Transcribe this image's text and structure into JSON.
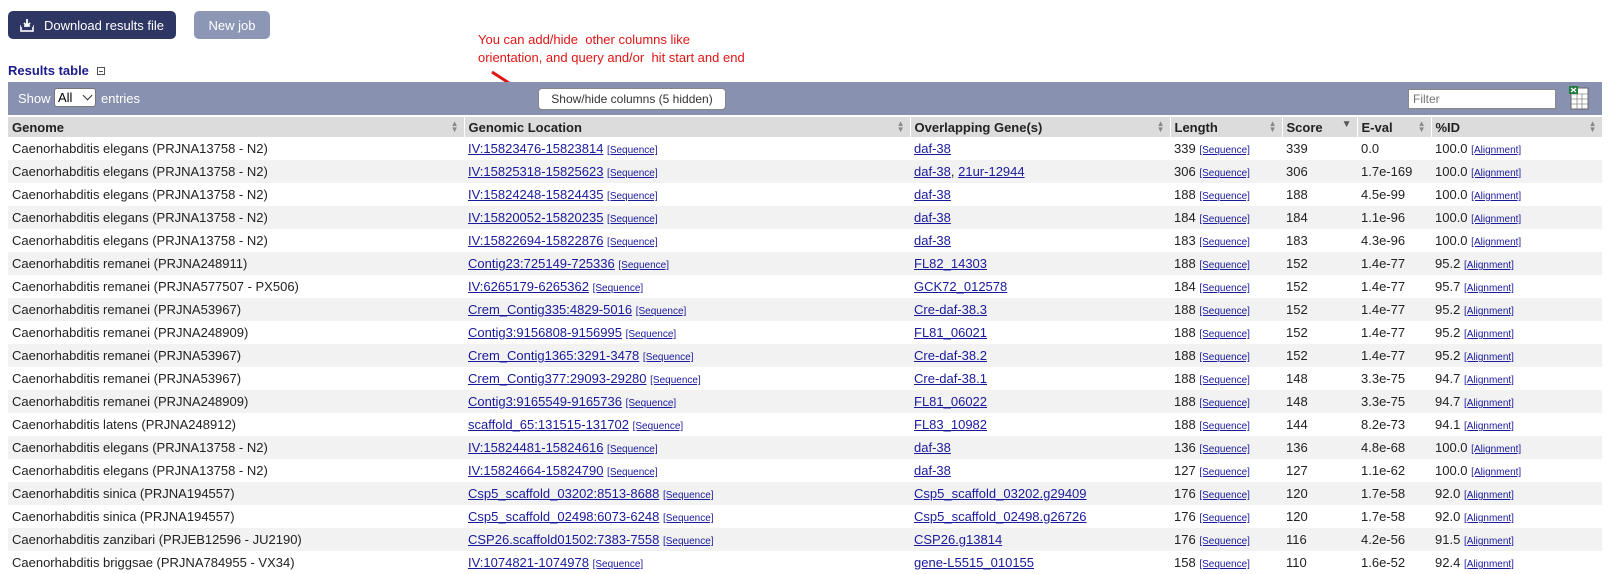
{
  "buttons": {
    "download": "Download results file",
    "new_job": "New job"
  },
  "annotation": {
    "line1": "You can add/hide  other columns like",
    "line2": "orientation, and query and/or  hit start and end"
  },
  "results_title": "Results table",
  "toolbar": {
    "show": "Show",
    "show_value": "All",
    "entries": "entries",
    "colvis": "Show/hide columns (5 hidden)",
    "filter_placeholder": "Filter"
  },
  "columns": [
    "Genome",
    "Genomic Location",
    "Overlapping Gene(s)",
    "Length",
    "Score",
    "E-val",
    "%ID"
  ],
  "link_labels": {
    "sequence": "[Sequence]",
    "alignment": "[Alignment]"
  },
  "rows": [
    {
      "genome": "Caenorhabditis elegans (PRJNA13758 - N2)",
      "location": "IV:15823476-15823814",
      "genes": [
        "daf-38"
      ],
      "length": "339",
      "score": "339",
      "eval": "0.0",
      "pid": "100.0"
    },
    {
      "genome": "Caenorhabditis elegans (PRJNA13758 - N2)",
      "location": "IV:15825318-15825623",
      "genes": [
        "daf-38",
        "21ur-12944"
      ],
      "length": "306",
      "score": "306",
      "eval": "1.7e-169",
      "pid": "100.0"
    },
    {
      "genome": "Caenorhabditis elegans (PRJNA13758 - N2)",
      "location": "IV:15824248-15824435",
      "genes": [
        "daf-38"
      ],
      "length": "188",
      "score": "188",
      "eval": "4.5e-99",
      "pid": "100.0"
    },
    {
      "genome": "Caenorhabditis elegans (PRJNA13758 - N2)",
      "location": "IV:15820052-15820235",
      "genes": [
        "daf-38"
      ],
      "length": "184",
      "score": "184",
      "eval": "1.1e-96",
      "pid": "100.0"
    },
    {
      "genome": "Caenorhabditis elegans (PRJNA13758 - N2)",
      "location": "IV:15822694-15822876",
      "genes": [
        "daf-38"
      ],
      "length": "183",
      "score": "183",
      "eval": "4.3e-96",
      "pid": "100.0"
    },
    {
      "genome": "Caenorhabditis remanei (PRJNA248911)",
      "location": "Contig23:725149-725336",
      "genes": [
        "FL82_14303"
      ],
      "length": "188",
      "score": "152",
      "eval": "1.4e-77",
      "pid": "95.2"
    },
    {
      "genome": "Caenorhabditis remanei (PRJNA577507 - PX506)",
      "location": "IV:6265179-6265362",
      "genes": [
        "GCK72_012578"
      ],
      "length": "184",
      "score": "152",
      "eval": "1.4e-77",
      "pid": "95.7"
    },
    {
      "genome": "Caenorhabditis remanei (PRJNA53967)",
      "location": "Crem_Contig335:4829-5016",
      "genes": [
        "Cre-daf-38.3"
      ],
      "length": "188",
      "score": "152",
      "eval": "1.4e-77",
      "pid": "95.2"
    },
    {
      "genome": "Caenorhabditis remanei (PRJNA248909)",
      "location": "Contig3:9156808-9156995",
      "genes": [
        "FL81_06021"
      ],
      "length": "188",
      "score": "152",
      "eval": "1.4e-77",
      "pid": "95.2"
    },
    {
      "genome": "Caenorhabditis remanei (PRJNA53967)",
      "location": "Crem_Contig1365:3291-3478",
      "genes": [
        "Cre-daf-38.2"
      ],
      "length": "188",
      "score": "152",
      "eval": "1.4e-77",
      "pid": "95.2"
    },
    {
      "genome": "Caenorhabditis remanei (PRJNA53967)",
      "location": "Crem_Contig377:29093-29280",
      "genes": [
        "Cre-daf-38.1"
      ],
      "length": "188",
      "score": "148",
      "eval": "3.3e-75",
      "pid": "94.7"
    },
    {
      "genome": "Caenorhabditis remanei (PRJNA248909)",
      "location": "Contig3:9165549-9165736",
      "genes": [
        "FL81_06022"
      ],
      "length": "188",
      "score": "148",
      "eval": "3.3e-75",
      "pid": "94.7"
    },
    {
      "genome": "Caenorhabditis latens (PRJNA248912)",
      "location": "scaffold_65:131515-131702",
      "genes": [
        "FL83_10982"
      ],
      "length": "188",
      "score": "144",
      "eval": "8.2e-73",
      "pid": "94.1"
    },
    {
      "genome": "Caenorhabditis elegans (PRJNA13758 - N2)",
      "location": "IV:15824481-15824616",
      "genes": [
        "daf-38"
      ],
      "length": "136",
      "score": "136",
      "eval": "4.8e-68",
      "pid": "100.0"
    },
    {
      "genome": "Caenorhabditis elegans (PRJNA13758 - N2)",
      "location": "IV:15824664-15824790",
      "genes": [
        "daf-38"
      ],
      "length": "127",
      "score": "127",
      "eval": "1.1e-62",
      "pid": "100.0"
    },
    {
      "genome": "Caenorhabditis sinica (PRJNA194557)",
      "location": "Csp5_scaffold_03202:8513-8688",
      "genes": [
        "Csp5_scaffold_03202.g29409"
      ],
      "length": "176",
      "score": "120",
      "eval": "1.7e-58",
      "pid": "92.0"
    },
    {
      "genome": "Caenorhabditis sinica (PRJNA194557)",
      "location": "Csp5_scaffold_02498:6073-6248",
      "genes": [
        "Csp5_scaffold_02498.g26726"
      ],
      "length": "176",
      "score": "120",
      "eval": "1.7e-58",
      "pid": "92.0"
    },
    {
      "genome": "Caenorhabditis zanzibari (PRJEB12596 - JU2190)",
      "location": "CSP26.scaffold01502:7383-7558",
      "genes": [
        "CSP26.g13814"
      ],
      "length": "176",
      "score": "116",
      "eval": "4.2e-56",
      "pid": "91.5"
    },
    {
      "genome": "Caenorhabditis briggsae (PRJNA784955 - VX34)",
      "location": "IV:1074821-1074978",
      "genes": [
        "gene-L5515_010155"
      ],
      "length": "158",
      "score": "110",
      "eval": "1.6e-52",
      "pid": "92.4"
    }
  ],
  "colors": {
    "primary_button": "#2e3663",
    "secondary_button": "#8c97b6",
    "toolbar": "#8892b0",
    "annotation": "#e01515",
    "link": "#1a1a9c"
  }
}
